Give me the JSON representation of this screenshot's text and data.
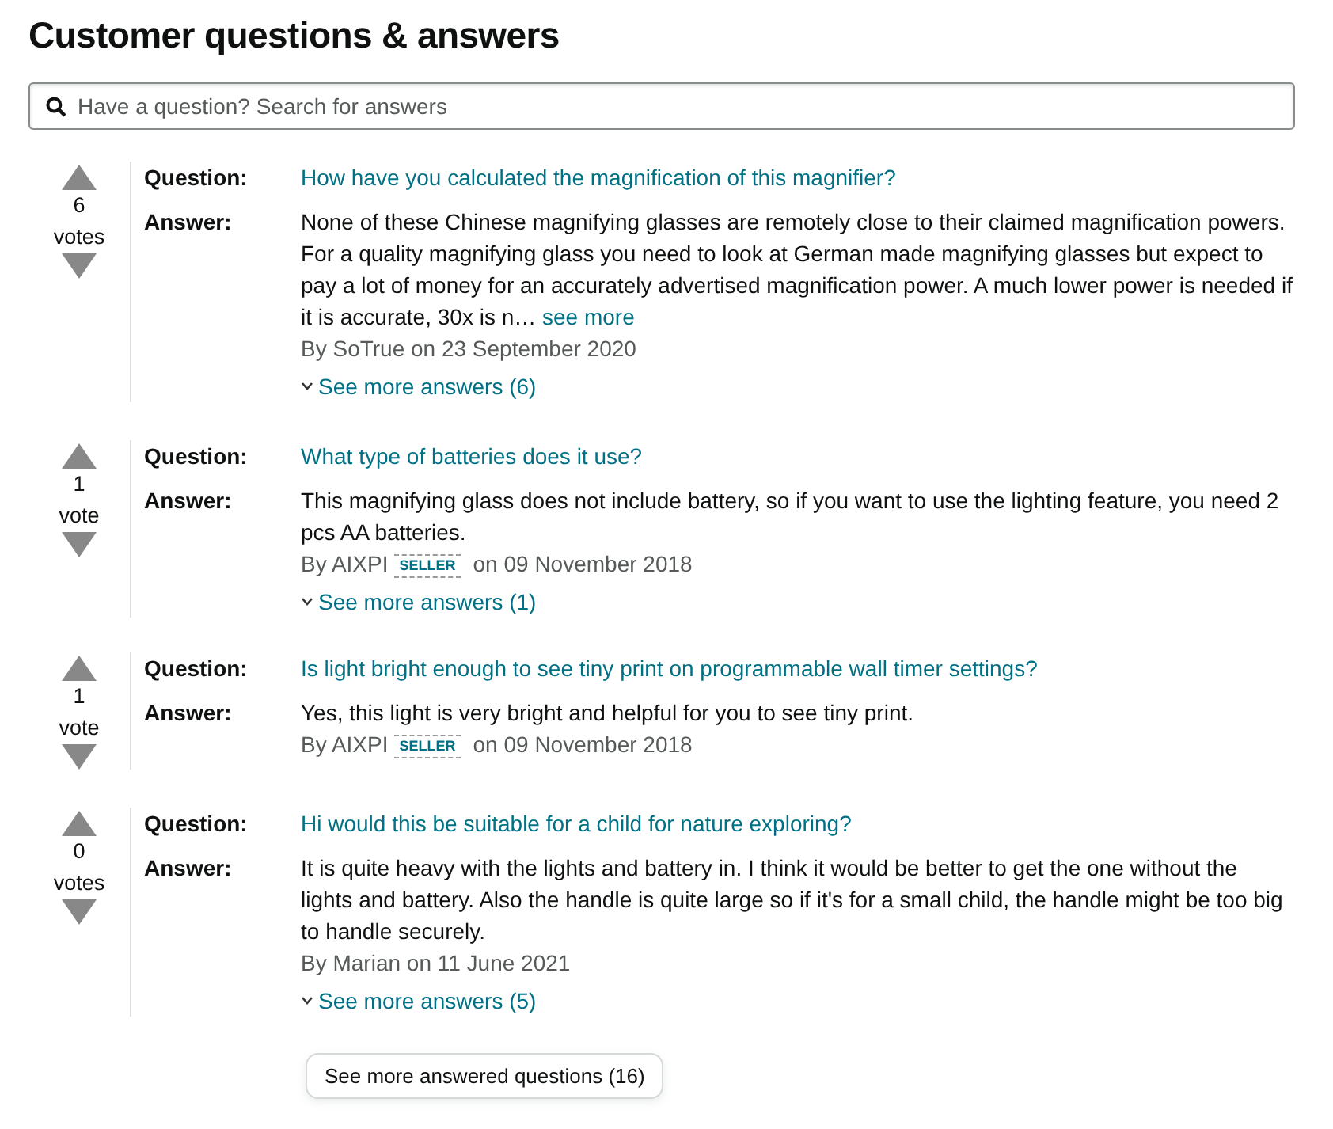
{
  "heading": "Customer questions & answers",
  "search": {
    "placeholder": "Have a question? Search for answers"
  },
  "questions": [
    {
      "votes": "6",
      "votes_label": "votes",
      "question_label": "Question:",
      "question": "How have you calculated the magnification of this magnifier?",
      "answer_label": "Answer:",
      "answer": "None of these Chinese magnifying glasses are remotely close to their claimed magnification powers. For a quality magnifying glass you need to look at German made magnifying glasses but expect to pay a lot of money for an accurately advertised magnification power. A much lower power is needed if it is accurate, 30x is n…",
      "see_more": "see more",
      "byline": "By SoTrue on 23 September 2020",
      "more_answers": "See more answers (6)"
    },
    {
      "votes": "1",
      "votes_label": "vote",
      "question_label": "Question:",
      "question": "What type of batteries does it use?",
      "answer_label": "Answer:",
      "answer": "This magnifying glass does not include battery, so if you want to use the lighting feature, you need 2 pcs AA batteries.",
      "byline": "By AIXPI",
      "badge": "SELLER",
      "date": "on 09 November 2018",
      "more_answers": "See more answers (1)"
    },
    {
      "votes": "1",
      "votes_label": "vote",
      "question_label": "Question:",
      "question": "Is light bright enough to see tiny print on programmable wall timer settings?",
      "answer_label": "Answer:",
      "answer": "Yes, this light is very bright and helpful for you to see tiny print.",
      "byline": "By AIXPI",
      "badge": "SELLER",
      "date": "on 09 November 2018"
    },
    {
      "votes": "0",
      "votes_label": "votes",
      "question_label": "Question:",
      "question": "Hi would this be suitable for a child for nature exploring?",
      "answer_label": "Answer:",
      "answer": "It is quite heavy with the lights and battery in. I think it would be better to get the one without the lights and battery. Also the handle is quite large so if it's for a small child, the handle might be too big to handle securely.",
      "byline": "By Marian on 11 June 2021",
      "more_answers": "See more answers (5)"
    }
  ],
  "more_questions_button": "See more answered questions (16)"
}
